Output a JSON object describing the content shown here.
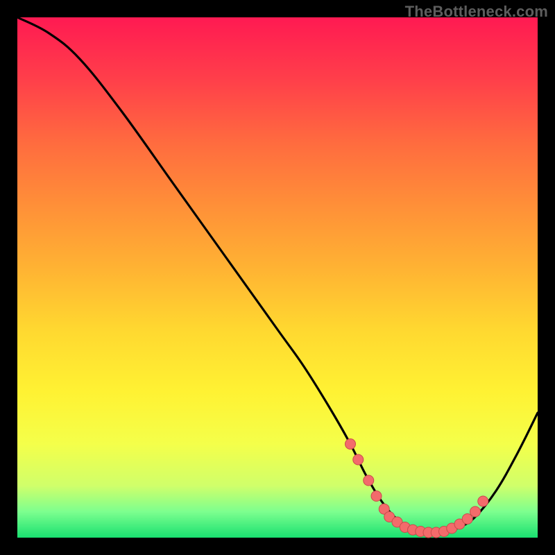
{
  "watermark": "TheBottleneck.com",
  "chart_data": {
    "type": "line",
    "title": "",
    "xlabel": "",
    "ylabel": "",
    "xlim": [
      0,
      100
    ],
    "ylim": [
      0,
      100
    ],
    "series": [
      {
        "name": "bottleneck-curve",
        "x": [
          0,
          6,
          12,
          20,
          30,
          40,
          50,
          55,
          60,
          64,
          67,
          70,
          73,
          76,
          79,
          82,
          85,
          88,
          92,
          96,
          100
        ],
        "y": [
          100,
          97,
          92,
          82,
          68,
          54,
          40,
          33,
          25,
          18,
          12,
          7,
          3.5,
          1.5,
          1,
          1,
          2,
          4,
          9,
          16,
          24
        ]
      }
    ],
    "markers": {
      "name": "highlight-dots",
      "color": "#f36b6b",
      "points": [
        {
          "x": 64.0,
          "y": 18.0
        },
        {
          "x": 65.5,
          "y": 15.0
        },
        {
          "x": 67.5,
          "y": 11.0
        },
        {
          "x": 69.0,
          "y": 8.0
        },
        {
          "x": 70.5,
          "y": 5.5
        },
        {
          "x": 71.5,
          "y": 4.0
        },
        {
          "x": 73.0,
          "y": 3.0
        },
        {
          "x": 74.5,
          "y": 2.0
        },
        {
          "x": 76.0,
          "y": 1.5
        },
        {
          "x": 77.5,
          "y": 1.2
        },
        {
          "x": 79.0,
          "y": 1.0
        },
        {
          "x": 80.5,
          "y": 1.0
        },
        {
          "x": 82.0,
          "y": 1.2
        },
        {
          "x": 83.5,
          "y": 1.8
        },
        {
          "x": 85.0,
          "y": 2.6
        },
        {
          "x": 86.5,
          "y": 3.6
        },
        {
          "x": 88.0,
          "y": 5.0
        },
        {
          "x": 89.5,
          "y": 7.0
        }
      ]
    }
  },
  "colors": {
    "curve_stroke": "#000000",
    "marker_fill": "#f36b6b",
    "marker_stroke": "#c84b4b"
  }
}
